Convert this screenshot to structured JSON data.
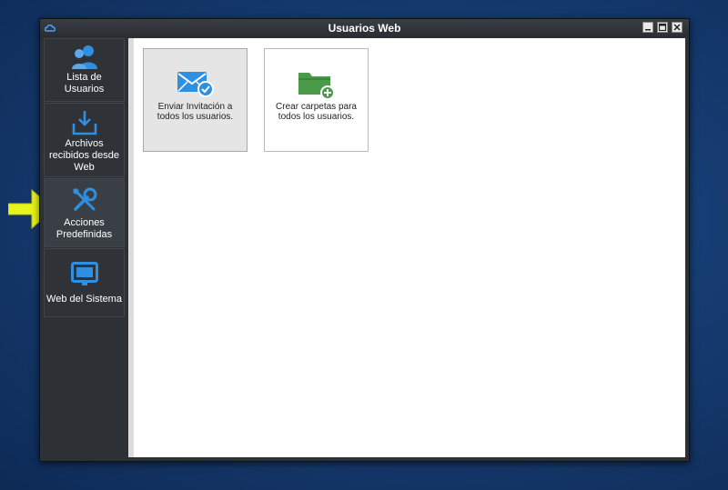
{
  "window": {
    "title": "Usuarios Web"
  },
  "sidebar": {
    "items": [
      {
        "label": "Lista de Usuarios",
        "icon": "users-icon"
      },
      {
        "label": "Archivos recibidos desde Web",
        "icon": "download-tray-icon"
      },
      {
        "label": "Acciones Predefinidas",
        "icon": "tools-icon",
        "active": true
      },
      {
        "label": "Web del Sistema",
        "icon": "monitor-icon"
      }
    ]
  },
  "main": {
    "tiles": [
      {
        "label": "Enviar Invitación a todos los usuarios.",
        "icon": "mail-check-icon",
        "selected": true
      },
      {
        "label": "Crear carpetas para todos los usuarios.",
        "icon": "folder-add-icon"
      }
    ]
  },
  "colors": {
    "accent_blue": "#2f8fe0",
    "folder_green": "#4a9a4a",
    "pointer_arrow": "#e8f51c",
    "desktop": "#163d73"
  }
}
